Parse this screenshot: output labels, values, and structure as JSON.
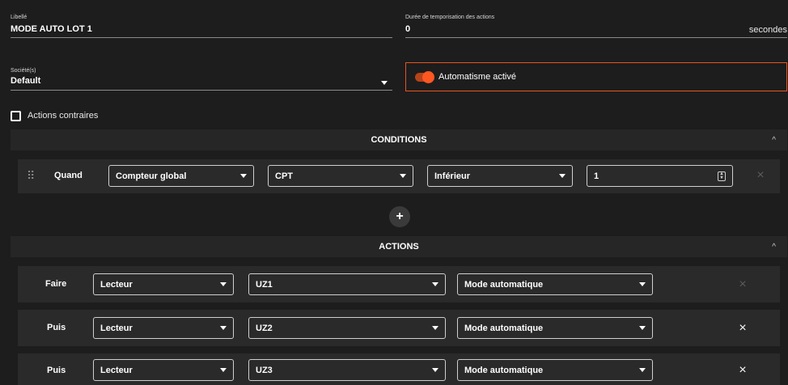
{
  "form": {
    "libelle": {
      "label": "Libellé",
      "value": "MODE AUTO LOT 1"
    },
    "duree": {
      "label": "Durée de temporisation des actions",
      "value": "0",
      "unit": "secondes"
    },
    "societe": {
      "label": "Société(s)",
      "value": "Default"
    },
    "automatisme": {
      "label": "Automatisme activé",
      "enabled": true,
      "accent": "#ff5722"
    },
    "actions_contraires": {
      "label": "Actions contraires",
      "checked": false
    }
  },
  "conditions": {
    "title": "CONDITIONS",
    "row": {
      "keyword": "Quand",
      "selects": [
        "Compteur global",
        "CPT",
        "Inférieur"
      ],
      "number": "1"
    },
    "add_label": "+"
  },
  "actions": {
    "title": "ACTIONS",
    "rows": [
      {
        "keyword": "Faire",
        "selects": [
          "Lecteur",
          "UZ1",
          "Mode automatique"
        ],
        "removable": false
      },
      {
        "keyword": "Puis",
        "selects": [
          "Lecteur",
          "UZ2",
          "Mode automatique"
        ],
        "removable": true
      },
      {
        "keyword": "Puis",
        "selects": [
          "Lecteur",
          "UZ3",
          "Mode automatique"
        ],
        "removable": true
      }
    ]
  },
  "icons": {
    "remove": "×",
    "collapse": "^",
    "drag": "⠿"
  }
}
